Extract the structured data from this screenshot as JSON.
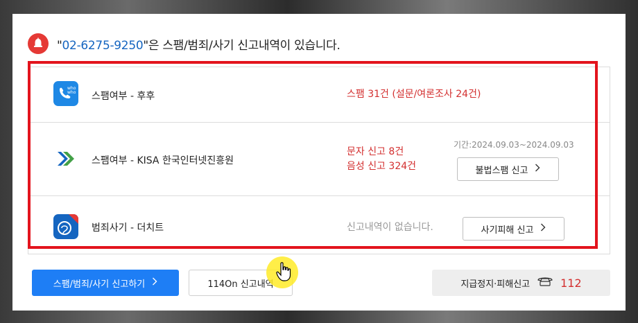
{
  "header": {
    "quote_open": "\"",
    "phone_number": "02-6275-9250",
    "quote_close_text": "\"은 스팸/범죄/사기 신고내역이 있습니다.",
    "alarm_icon": "alarm-bell-icon"
  },
  "rows": [
    {
      "service": "스팸여부 - 후후",
      "result_lines": [
        "스팸 31건 (설문/여론조사 24건)"
      ],
      "icon": "whowho-app-icon"
    },
    {
      "service": "스팸여부 - KISA 한국인터넷진흥원",
      "result_lines": [
        "문자 신고 8건",
        "음성 신고 324건"
      ],
      "period": "기간:2024.09.03~2024.09.03",
      "button_label": "불법스팸 신고",
      "icon": "kisa-logo-icon"
    },
    {
      "service": "범죄사기 - 더치트",
      "result_lines": [
        "신고내역이 없습니다."
      ],
      "button_label": "사기피해 신고",
      "icon": "thecheat-app-icon"
    }
  ],
  "footer": {
    "report_button": "스팸/범죄/사기 신고하기",
    "history_button": "114On 신고내역",
    "emergency_label": "지급정지·피해신고",
    "emergency_number": "112"
  },
  "colors": {
    "accent_blue": "#1e7ef5",
    "alert_red": "#d32f2f",
    "highlight_box": "#e3141d"
  }
}
